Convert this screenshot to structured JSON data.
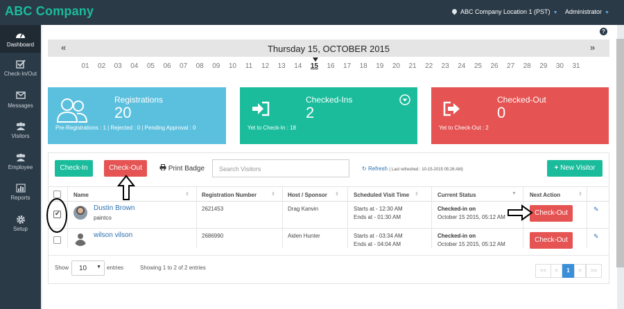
{
  "header": {
    "brand": "ABC Company",
    "location": "ABC Company Location 1 (PST)",
    "user": "Administrator"
  },
  "sidebar": {
    "items": [
      {
        "label": "Dashboard",
        "icon": "dashboard-icon"
      },
      {
        "label": "Check-In/Out",
        "icon": "check-square-icon"
      },
      {
        "label": "Messages",
        "icon": "envelope-icon"
      },
      {
        "label": "Visitors",
        "icon": "users-icon"
      },
      {
        "label": "Employee",
        "icon": "users-icon"
      },
      {
        "label": "Reports",
        "icon": "bar-chart-icon"
      },
      {
        "label": "Setup",
        "icon": "gear-icon"
      }
    ]
  },
  "calendar": {
    "prev": "«",
    "next": "»",
    "title": "Thursday 15, OCTOBER 2015",
    "days": [
      "01",
      "02",
      "03",
      "04",
      "05",
      "06",
      "07",
      "08",
      "09",
      "10",
      "11",
      "12",
      "13",
      "14",
      "15",
      "16",
      "17",
      "18",
      "19",
      "20",
      "21",
      "22",
      "23",
      "24",
      "25",
      "26",
      "27",
      "28",
      "29",
      "30",
      "31"
    ],
    "selected": "15"
  },
  "cards": {
    "registrations": {
      "title": "Registrations",
      "count": "20",
      "sub": "Pre-Registrations : 1 | Rejected : 0 | Pending Approval : 0"
    },
    "checkedins": {
      "title": "Checked-Ins",
      "count": "2",
      "sub": "Yet to Check-In : 18"
    },
    "checkedout": {
      "title": "Checked-Out",
      "count": "0",
      "sub": "Yet to Check-Out : 2"
    }
  },
  "toolbar": {
    "checkin": "Check-In",
    "checkout": "Check-Out",
    "print": "Print Badge",
    "search_placeholder": "Search Visitors",
    "refresh": "Refresh",
    "last_refreshed": "( Last refreshed : 10-15-2015 05:26 AM)",
    "new_visitor": "New Visitor"
  },
  "table": {
    "columns": [
      "Name",
      "Registration Number",
      "Host / Sponsor",
      "Scheduled Visit Time",
      "Current Status",
      "Next Action"
    ],
    "rows": [
      {
        "name": "Dustin Brown",
        "company": "paintco",
        "reg": "2621453",
        "host": "Drag Kanvin",
        "start": "Starts at - 12:30 AM",
        "end": "Ends at - 01:30 AM",
        "status": "Checked-in on",
        "status_time": "October 15 2015, 05:12 AM",
        "action": "Check-Out",
        "checked": true
      },
      {
        "name": "wilson vilson",
        "company": "",
        "reg": "2686990",
        "host": "Aiden Hunter",
        "start": "Starts at - 03:34 AM",
        "end": "Ends at - 04:04 AM",
        "status": "Checked-in on",
        "status_time": "October 15 2015, 05:12 AM",
        "action": "Check-Out",
        "checked": false
      }
    ]
  },
  "footer": {
    "show": "Show",
    "page_size": "10",
    "entries": "entries",
    "showing": "Showing 1 to 2 of 2 entries",
    "pager": {
      "first": "<<",
      "prev": "<",
      "current": "1",
      "next": ">",
      "last": ">>"
    }
  }
}
